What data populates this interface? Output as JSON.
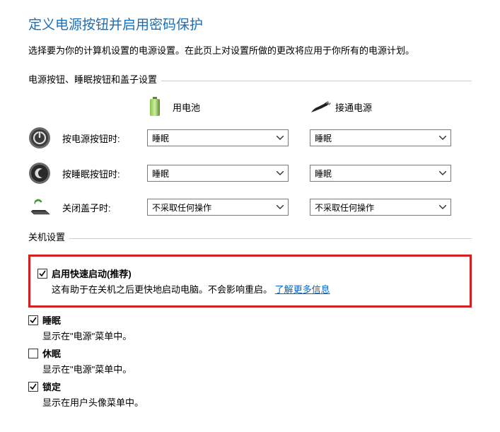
{
  "title": "定义电源按钮并启用密码保护",
  "subtitle": "选择要为你的计算机设置的电源设置。在此页上对设置所做的更改将应用于你所有的电源计划。",
  "group1_title": "电源按钮、睡眠按钮和盖子设置",
  "headers": {
    "battery": "用电池",
    "ac": "接通电源"
  },
  "rows": {
    "power_btn": {
      "label": "按电源按钮时:",
      "battery": "睡眠",
      "ac": "睡眠"
    },
    "sleep_btn": {
      "label": "按睡眠按钮时:",
      "battery": "睡眠",
      "ac": "睡眠"
    },
    "lid": {
      "label": "关闭盖子时:",
      "battery": "不采取任何操作",
      "ac": "不采取任何操作"
    }
  },
  "group2_title": "关机设置",
  "shutdown": {
    "fast": {
      "label": "启用快速启动(推荐)",
      "desc": "这有助于在关机之后更快地启动电脑。不会影响重启。",
      "link": "了解更多信息",
      "checked": true
    },
    "sleep": {
      "label": "睡眠",
      "desc": "显示在\"电源\"菜单中。",
      "checked": true
    },
    "hibernate": {
      "label": "休眠",
      "desc": "显示在\"电源\"菜单中。",
      "checked": false
    },
    "lock": {
      "label": "锁定",
      "desc": "显示在用户头像菜单中。",
      "checked": true
    }
  }
}
